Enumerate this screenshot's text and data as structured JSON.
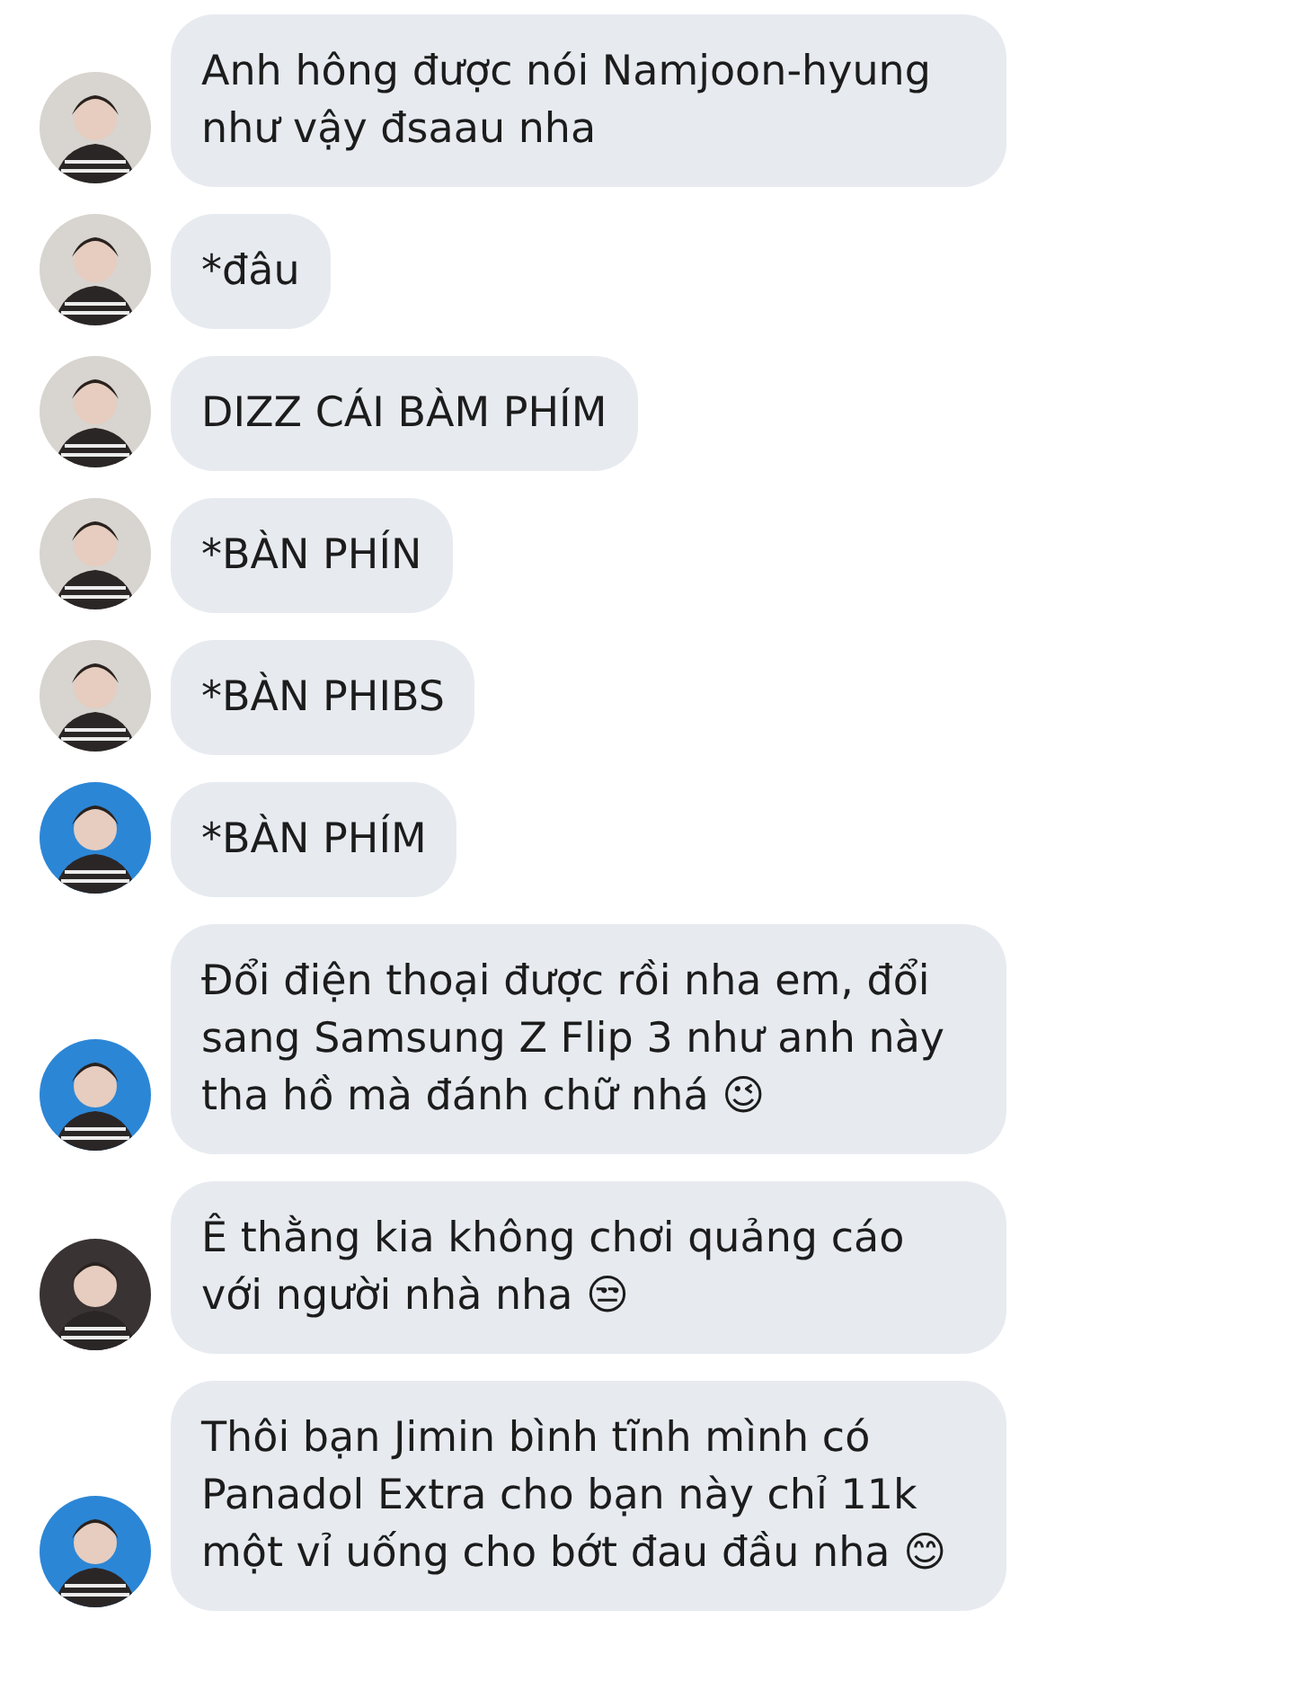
{
  "messages": [
    {
      "color": "#d8d4cf",
      "text": "Anh hông được nói Namjoon-hyung như vậy đsaau nha"
    },
    {
      "color": "#d8d4cf",
      "text": "*đâu"
    },
    {
      "color": "#d8d4cf",
      "text": "DIZZ CÁI BÀM PHÍM"
    },
    {
      "color": "#d8d4cf",
      "text": "*BÀN PHÍN"
    },
    {
      "color": "#d8d4cf",
      "text": "*BÀN PHIBS"
    },
    {
      "color": "#2c86d6",
      "text": "*BÀN PHÍM"
    },
    {
      "color": "#2c86d6",
      "text": "Đổi điện thoại được rồi nha em, đổi sang Samsung Z Flip 3 như anh này tha hồ mà đánh chữ nhá 😉"
    },
    {
      "color": "#3a3333",
      "text": "Ê thằng kia không chơi quảng cáo với người nhà nha 😒"
    },
    {
      "color": "#2c86d6",
      "text": "Thôi bạn Jimin bình tĩnh mình có Panadol Extra cho bạn này chỉ 11k một vỉ uống cho bớt đau đầu nha 😊"
    }
  ]
}
